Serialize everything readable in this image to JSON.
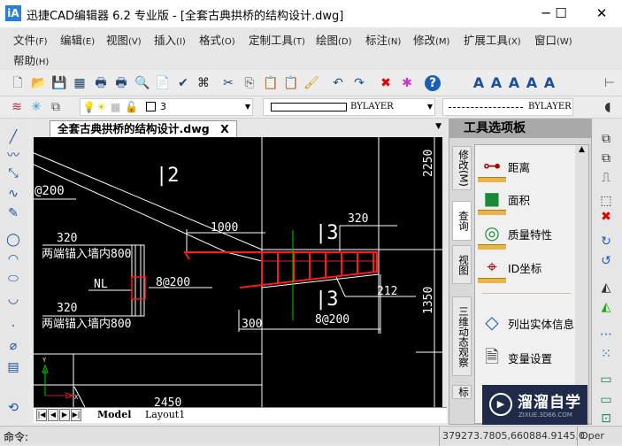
{
  "window": {
    "title": "迅捷CAD编辑器 6.2 专业版  - [全套古典拱桥的结构设计.dwg]",
    "app_icon": "iA",
    "minimize": "─",
    "maximize": "☐",
    "close": "✕"
  },
  "menu": [
    {
      "label": "文件",
      "key": "(F)"
    },
    {
      "label": "编辑",
      "key": "(E)"
    },
    {
      "label": "视图",
      "key": "(V)"
    },
    {
      "label": "插入",
      "key": "(I)"
    },
    {
      "label": "格式",
      "key": "(O)"
    },
    {
      "label": "定制工具",
      "key": "(T)"
    },
    {
      "label": "绘图",
      "key": "(D)"
    },
    {
      "label": "标注",
      "key": "(N)"
    },
    {
      "label": "修改",
      "key": "(M)"
    },
    {
      "label": "扩展工具",
      "key": "(X)"
    },
    {
      "label": "窗口",
      "key": "(W)"
    },
    {
      "label": "帮助",
      "key": "(H)"
    }
  ],
  "toolbar1": [
    {
      "name": "new-icon",
      "g": "🗋",
      "c": "#555"
    },
    {
      "name": "open-icon",
      "g": "📂",
      "c": "#d89a20"
    },
    {
      "name": "save-icon",
      "g": "💾",
      "c": "#7a2a7a"
    },
    {
      "name": "acis-icon",
      "g": "▦",
      "c": "#246"
    },
    {
      "name": "print-export-icon",
      "g": "🖶",
      "c": "#247"
    },
    {
      "name": "print-icon",
      "g": "🖶",
      "c": "#247"
    },
    {
      "name": "print-preview-icon",
      "g": "🔍",
      "c": "#247"
    },
    {
      "name": "page-setup-icon",
      "g": "📄",
      "c": "#247"
    },
    {
      "name": "spell-check-icon",
      "g": "✔",
      "c": "#247"
    },
    {
      "name": "find-icon",
      "g": "⌘",
      "c": "#222"
    },
    {
      "name": "cut-icon",
      "g": "✂",
      "c": "#247"
    },
    {
      "name": "copy-icon",
      "g": "⎘",
      "c": "#555"
    },
    {
      "name": "paste-icon",
      "g": "📋",
      "c": "#a67"
    },
    {
      "name": "paste-special-icon",
      "g": "📋",
      "c": "#555"
    },
    {
      "name": "match-properties-icon",
      "g": "🖌",
      "c": "#c90"
    },
    {
      "name": "undo-icon",
      "g": "↶",
      "c": "#1a4fa0"
    },
    {
      "name": "redo-icon",
      "g": "↷",
      "c": "#1a4fa0"
    },
    {
      "name": "delete-icon",
      "g": "✖",
      "c": "#d00"
    },
    {
      "name": "purge-icon",
      "g": "✱",
      "c": "#c3c"
    },
    {
      "name": "help-icon",
      "g": "?",
      "c": "#fff"
    }
  ],
  "text_tools": [
    {
      "name": "text-style-icon",
      "g": "A"
    },
    {
      "name": "single-text-icon",
      "g": "A"
    },
    {
      "name": "edit-text-icon",
      "g": "A"
    },
    {
      "name": "text-format-icon",
      "g": "A"
    },
    {
      "name": "find-text-icon",
      "g": "A"
    }
  ],
  "layer": {
    "current": "3",
    "linetype": "BYLAYER",
    "lineweight": "BYLAYER",
    "icons": [
      "layer-manager-icon",
      "layer-freeze-icon",
      "layer-state-icon",
      "bulb-icon",
      "sun-icon",
      "layer-color-icon",
      "lock-icon"
    ]
  },
  "document_tab": {
    "label": "全套古典拱桥的结构设计.dwg",
    "close": "X",
    "dropdown": "▼"
  },
  "drawing": {
    "labels": {
      "sec2": "|2",
      "at200": "@200",
      "dim1000": "1000",
      "sec3_top": "|3",
      "dim320_right": "320",
      "dim212": "212",
      "sec3_bottom": "|3",
      "rebar_right": "8@200",
      "dim300": "300",
      "dim2250": "2250",
      "dim1350": "1350",
      "dim320_a": "320",
      "anchor_a": "两端锚入墙内800",
      "nl": "NL",
      "rebar_left": "8@200",
      "dim320_b": "320",
      "anchor_b": "两端锚入墙内800",
      "dim2450": "2450",
      "ucs_x": "X",
      "ucs_y": "Y"
    },
    "colors": {
      "background": "#000000",
      "lines": "#ffffff",
      "rebar": "#ff1a1a",
      "axis": "#00cc00"
    }
  },
  "layout_tabs": {
    "model": "Model",
    "layout1": "Layout1",
    "nav": [
      "|◀",
      "◀",
      "▶",
      "▶|"
    ]
  },
  "palette": {
    "title": "工具选项板",
    "side_tabs": [
      "修改(M)",
      "查询",
      "视图",
      "三维动态观察",
      "标"
    ],
    "active_tab": "查询",
    "items": [
      {
        "label": "距离",
        "icon": "distance-icon"
      },
      {
        "label": "面积",
        "icon": "area-icon"
      },
      {
        "label": "质量特性",
        "icon": "mass-properties-icon"
      },
      {
        "label": "ID坐标",
        "icon": "id-point-icon"
      },
      {
        "label": "列出实体信息",
        "icon": "list-info-icon"
      },
      {
        "label": "变量设置",
        "icon": "setvar-icon"
      }
    ]
  },
  "left_tools": [
    "line-icon",
    "polyline-icon",
    "ray-icon",
    "arc-spline-icon",
    "pencil-icon",
    "circle-icon",
    "arc-icon",
    "ellipse-icon",
    "ellipse-arc-icon",
    "point-icon",
    "spiral-icon",
    "table-icon",
    "refresh-icon"
  ],
  "right_tools": [
    {
      "n": "copy-tool-icon",
      "g": "⧉",
      "c": "#333"
    },
    {
      "n": "copy-multiple-icon",
      "g": "⧉",
      "c": "#333"
    },
    {
      "n": "offset-icon",
      "g": "⎍",
      "c": "#333"
    },
    {
      "n": "array-icon",
      "g": "⬚",
      "c": "#333"
    },
    {
      "n": "erase-icon",
      "g": "✖",
      "c": "#d00"
    },
    {
      "n": "rotate-icon",
      "g": "↻",
      "c": "#1a5fb4"
    },
    {
      "n": "rotate-copy-icon",
      "g": "↺",
      "c": "#1a5fb4"
    },
    {
      "n": "mirror-icon",
      "g": "◭",
      "c": "#333"
    },
    {
      "n": "mirror-copy-icon",
      "g": "◭",
      "c": "#2a2"
    },
    {
      "n": "scale-icon",
      "g": "⋯",
      "c": "#1a5fb4"
    },
    {
      "n": "stretch-icon",
      "g": "⁙",
      "c": "#1a5fb4"
    },
    {
      "n": "trim-icon",
      "g": "▭",
      "c": "#185"
    },
    {
      "n": "extend-icon",
      "g": "▭",
      "c": "#185"
    },
    {
      "n": "break-icon",
      "g": "⊡",
      "c": "#185"
    }
  ],
  "status": {
    "command_label": "命令:",
    "coordinates": "379273.7805,660884.9145,0",
    "mode": "Oper"
  },
  "watermark": {
    "brand": "溜溜自学",
    "url": "ZIXUE.3D66.COM"
  }
}
